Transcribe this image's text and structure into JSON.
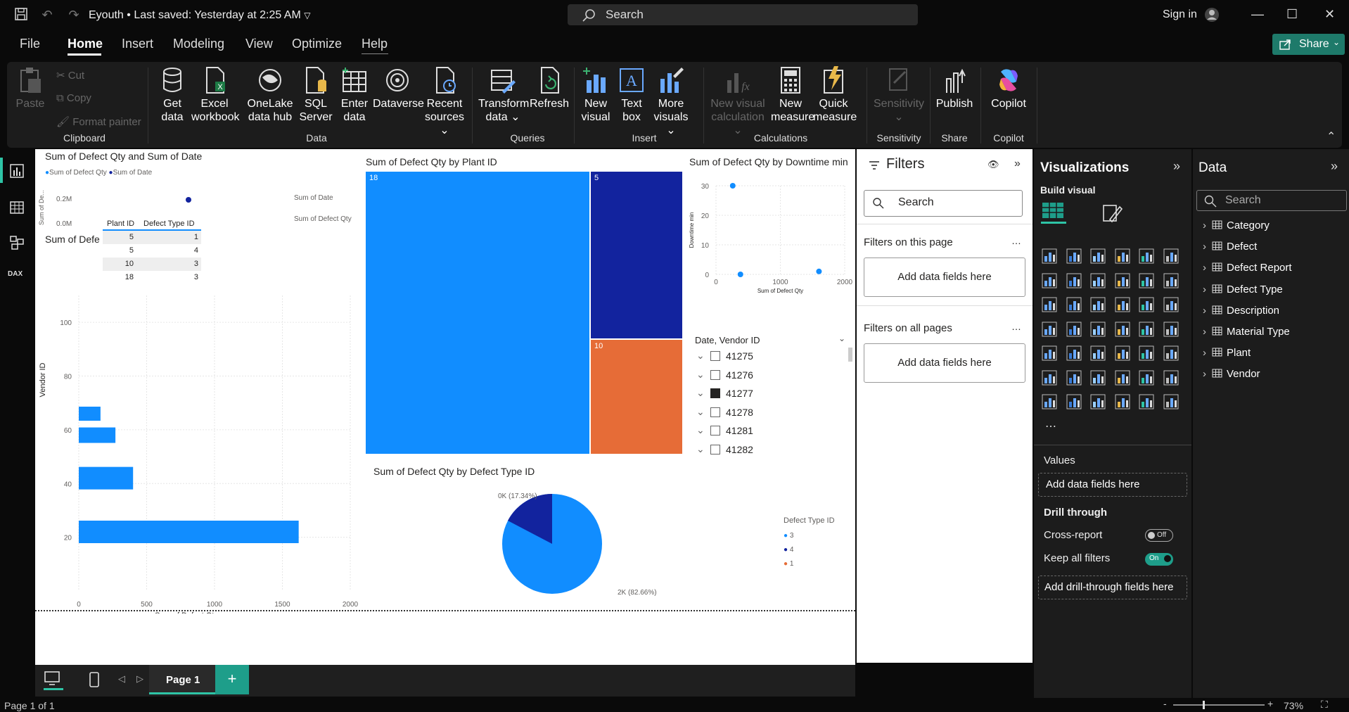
{
  "app": {
    "file_name": "Eyouth",
    "save_status": "Last saved: Yesterday at 2:25 AM",
    "search_placeholder": "Search",
    "sign_in": "Sign in",
    "share": "Share"
  },
  "menu": [
    "File",
    "Home",
    "Insert",
    "Modeling",
    "View",
    "Optimize",
    "Help"
  ],
  "ribbon": {
    "clipboard": {
      "paste": "Paste",
      "cut": "Cut",
      "copy": "Copy",
      "format_painter": "Format painter",
      "label": "Clipboard"
    },
    "data": {
      "get_data": "Get data",
      "excel": "Excel workbook",
      "onelake": "OneLake data hub",
      "sql": "SQL Server",
      "enter": "Enter data",
      "dataverse": "Dataverse",
      "recent": "Recent sources",
      "label": "Data"
    },
    "queries": {
      "transform": "Transform data",
      "refresh": "Refresh",
      "label": "Queries"
    },
    "insert": {
      "new_visual": "New visual",
      "text_box": "Text box",
      "more_visuals": "More visuals",
      "label": "Insert"
    },
    "calculations": {
      "new_visual_calc": "New visual calculation",
      "new_measure": "New measure",
      "quick_measure": "Quick measure",
      "label": "Calculations"
    },
    "sensitivity": {
      "btn": "Sensitivity",
      "label": "Sensitivity"
    },
    "share": {
      "publish": "Publish",
      "label": "Share"
    },
    "copilot": {
      "btn": "Copilot",
      "label": "Copilot"
    }
  },
  "visuals": {
    "combo": {
      "title": "Sum of Defect Qty and Sum of Date",
      "legend1": "Sum of Defect Qty",
      "legend2": "Sum of Date",
      "tick_02m": "0.2M",
      "tick_00m": "0.0M",
      "ylabel": "Sum of De...",
      "label_date": "Sum of Date",
      "label_qty": "Sum of Defect Qty"
    },
    "table": {
      "headers": [
        "Plant ID",
        "Defect Type ID"
      ],
      "rows": [
        [
          "5",
          "1"
        ],
        [
          "5",
          "4"
        ],
        [
          "10",
          "3"
        ],
        [
          "18",
          "3"
        ]
      ]
    },
    "bar": {
      "title": "Sum of Defe",
      "ylabel": "Vendor ID",
      "xlabel": "Sum of Defect Qty",
      "yticks": [
        "100",
        "80",
        "60",
        "40",
        "20"
      ],
      "xticks": [
        "0",
        "500",
        "1000",
        "1500",
        "2000"
      ]
    },
    "treemap": {
      "title": "Sum of Defect Qty by Plant ID",
      "labels": [
        "18",
        "5",
        "10"
      ],
      "colors": [
        "#118dff",
        "#12239e",
        "#e66c37"
      ]
    },
    "scatter": {
      "title": "Sum of Defect Qty by Downtime min",
      "ylabel": "Downtime min",
      "xlabel": "Sum of Defect Qty",
      "yticks": [
        "30",
        "20",
        "10",
        "0"
      ],
      "xticks": [
        "0",
        "1000",
        "2000"
      ]
    },
    "slicer": {
      "title": "Date, Vendor ID",
      "items": [
        {
          "label": "41275",
          "checked": false
        },
        {
          "label": "41276",
          "checked": false
        },
        {
          "label": "41277",
          "checked": true
        },
        {
          "label": "41278",
          "checked": false
        },
        {
          "label": "41281",
          "checked": false
        },
        {
          "label": "41282",
          "checked": false
        }
      ]
    },
    "pie": {
      "title": "Sum of Defect Qty by Defect Type ID",
      "label_small": "0K (17.34%)",
      "label_big": "2K (82.66%)",
      "legend_title": "Defect Type ID",
      "legend": [
        "3",
        "4",
        "1"
      ]
    }
  },
  "chart_data": [
    {
      "type": "bar",
      "title": "Sum of Defe",
      "xlabel": "Sum of Defect Qty",
      "ylabel": "Vendor ID",
      "orientation": "horizontal",
      "xlim": [
        0,
        2000
      ],
      "ylim": [
        0,
        110
      ],
      "categories": [
        "66",
        "58",
        "42",
        "22"
      ],
      "values": [
        160,
        270,
        400,
        1620
      ]
    },
    {
      "type": "scatter",
      "title": "Sum of Defect Qty by Downtime min",
      "xlabel": "Sum of Defect Qty",
      "ylabel": "Downtime min",
      "xlim": [
        0,
        2000
      ],
      "ylim": [
        0,
        30
      ],
      "x": [
        260,
        380,
        1600
      ],
      "y": [
        30,
        0,
        1
      ]
    },
    {
      "type": "pie",
      "title": "Sum of Defect Qty by Defect Type ID",
      "categories": [
        "3",
        "4",
        "1"
      ],
      "values": [
        82.66,
        17.34,
        0
      ]
    }
  ],
  "filters": {
    "title": "Filters",
    "search": "Search",
    "on_page": "Filters on this page",
    "on_all": "Filters on all pages",
    "add": "Add data fields here"
  },
  "viz": {
    "title": "Visualizations",
    "build": "Build visual",
    "values": "Values",
    "add_values": "Add data fields here",
    "drill": "Drill through",
    "cross": "Cross-report",
    "cross_state": "Off",
    "keep": "Keep all filters",
    "keep_state": "On",
    "add_drill": "Add drill-through fields here"
  },
  "data_pane": {
    "title": "Data",
    "search": "Search",
    "tables": [
      "Category",
      "Defect",
      "Defect Report",
      "Defect Type",
      "Description",
      "Material Type",
      "Plant",
      "Vendor"
    ]
  },
  "pages": {
    "page1": "Page 1",
    "add": "+"
  },
  "status": {
    "page": "Page 1 of 1",
    "zoom": "73%"
  }
}
